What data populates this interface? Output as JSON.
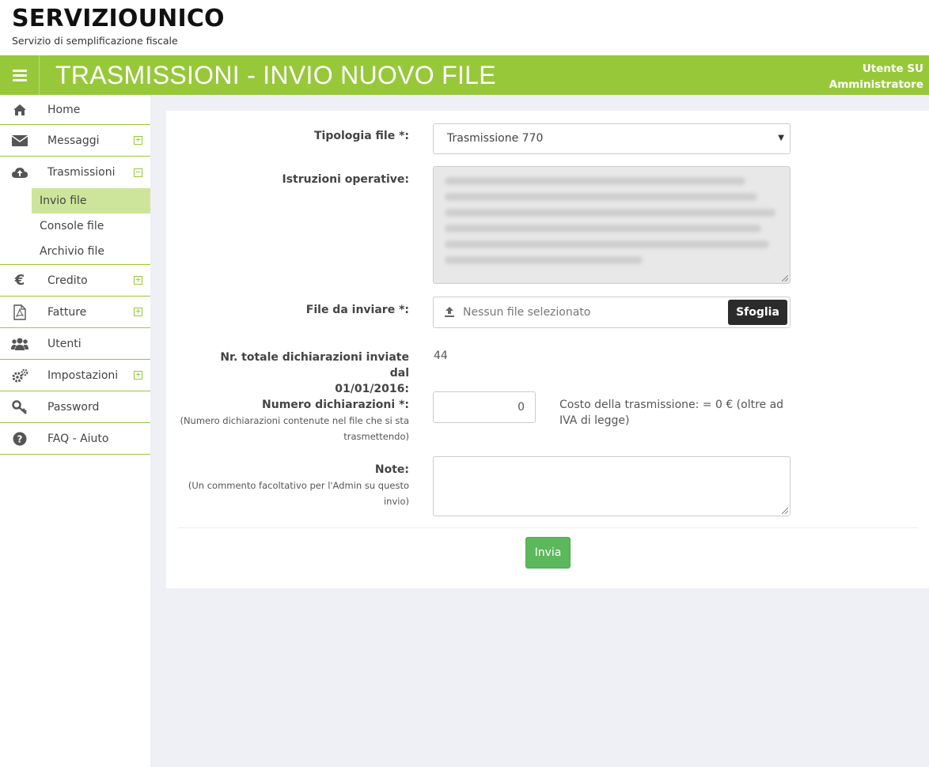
{
  "brand": {
    "title": "SERVIZIOUNICO",
    "subtitle": "Servizio di semplificazione fiscale"
  },
  "topbar": {
    "page_title": "TRASMISSIONI - INVIO NUOVO FILE",
    "user_name": "Utente SU",
    "user_role": "Amministratore"
  },
  "sidebar": {
    "items": [
      {
        "label": "Home",
        "icon": "home-icon"
      },
      {
        "label": "Messaggi",
        "icon": "envelope-icon",
        "toggle": "+"
      },
      {
        "label": "Trasmissioni",
        "icon": "cloud-upload-icon",
        "toggle": "−"
      },
      {
        "label": "Credito",
        "icon": "euro-icon",
        "toggle": "+"
      },
      {
        "label": "Fatture",
        "icon": "pdf-file-icon",
        "toggle": "+"
      },
      {
        "label": "Utenti",
        "icon": "users-icon"
      },
      {
        "label": "Impostazioni",
        "icon": "gears-icon",
        "toggle": "+"
      },
      {
        "label": "Password",
        "icon": "key-icon"
      },
      {
        "label": "FAQ - Aiuto",
        "icon": "question-circle-icon"
      }
    ],
    "sub_items": [
      {
        "label": "Invio file",
        "active": true
      },
      {
        "label": "Console file"
      },
      {
        "label": "Archivio file"
      }
    ]
  },
  "form": {
    "tipologia_label": "Tipologia file *:",
    "tipologia_value": "Trasmissione 770",
    "istruzioni_label": "Istruzioni operative:",
    "file_label": "File da inviare *:",
    "file_placeholder": "Nessun file selezionato",
    "browse_label": "Sfoglia",
    "totale_label_line1": "Nr. totale dichiarazioni inviate dal",
    "totale_label_line2": "01/01/2016:",
    "totale_value": "44",
    "numero_label": "Numero dichiarazioni *:",
    "numero_hint_line1": "(Numero dichiarazioni contenute nel file che si sta",
    "numero_hint_line2": "trasmettendo)",
    "numero_value": "0",
    "costo_text": "Costo della trasmissione: = 0 € (oltre ad IVA di legge)",
    "note_label": "Note:",
    "note_hint_line1": "(Un commento facoltativo per l'Admin su questo",
    "note_hint_line2": "invio)",
    "submit_label": "Invia"
  },
  "colors": {
    "accent": "#97c83a",
    "active_bg": "#cde59a",
    "submit": "#5cb85c",
    "browse": "#2b2b2b",
    "main_bg": "#eff0f5"
  }
}
